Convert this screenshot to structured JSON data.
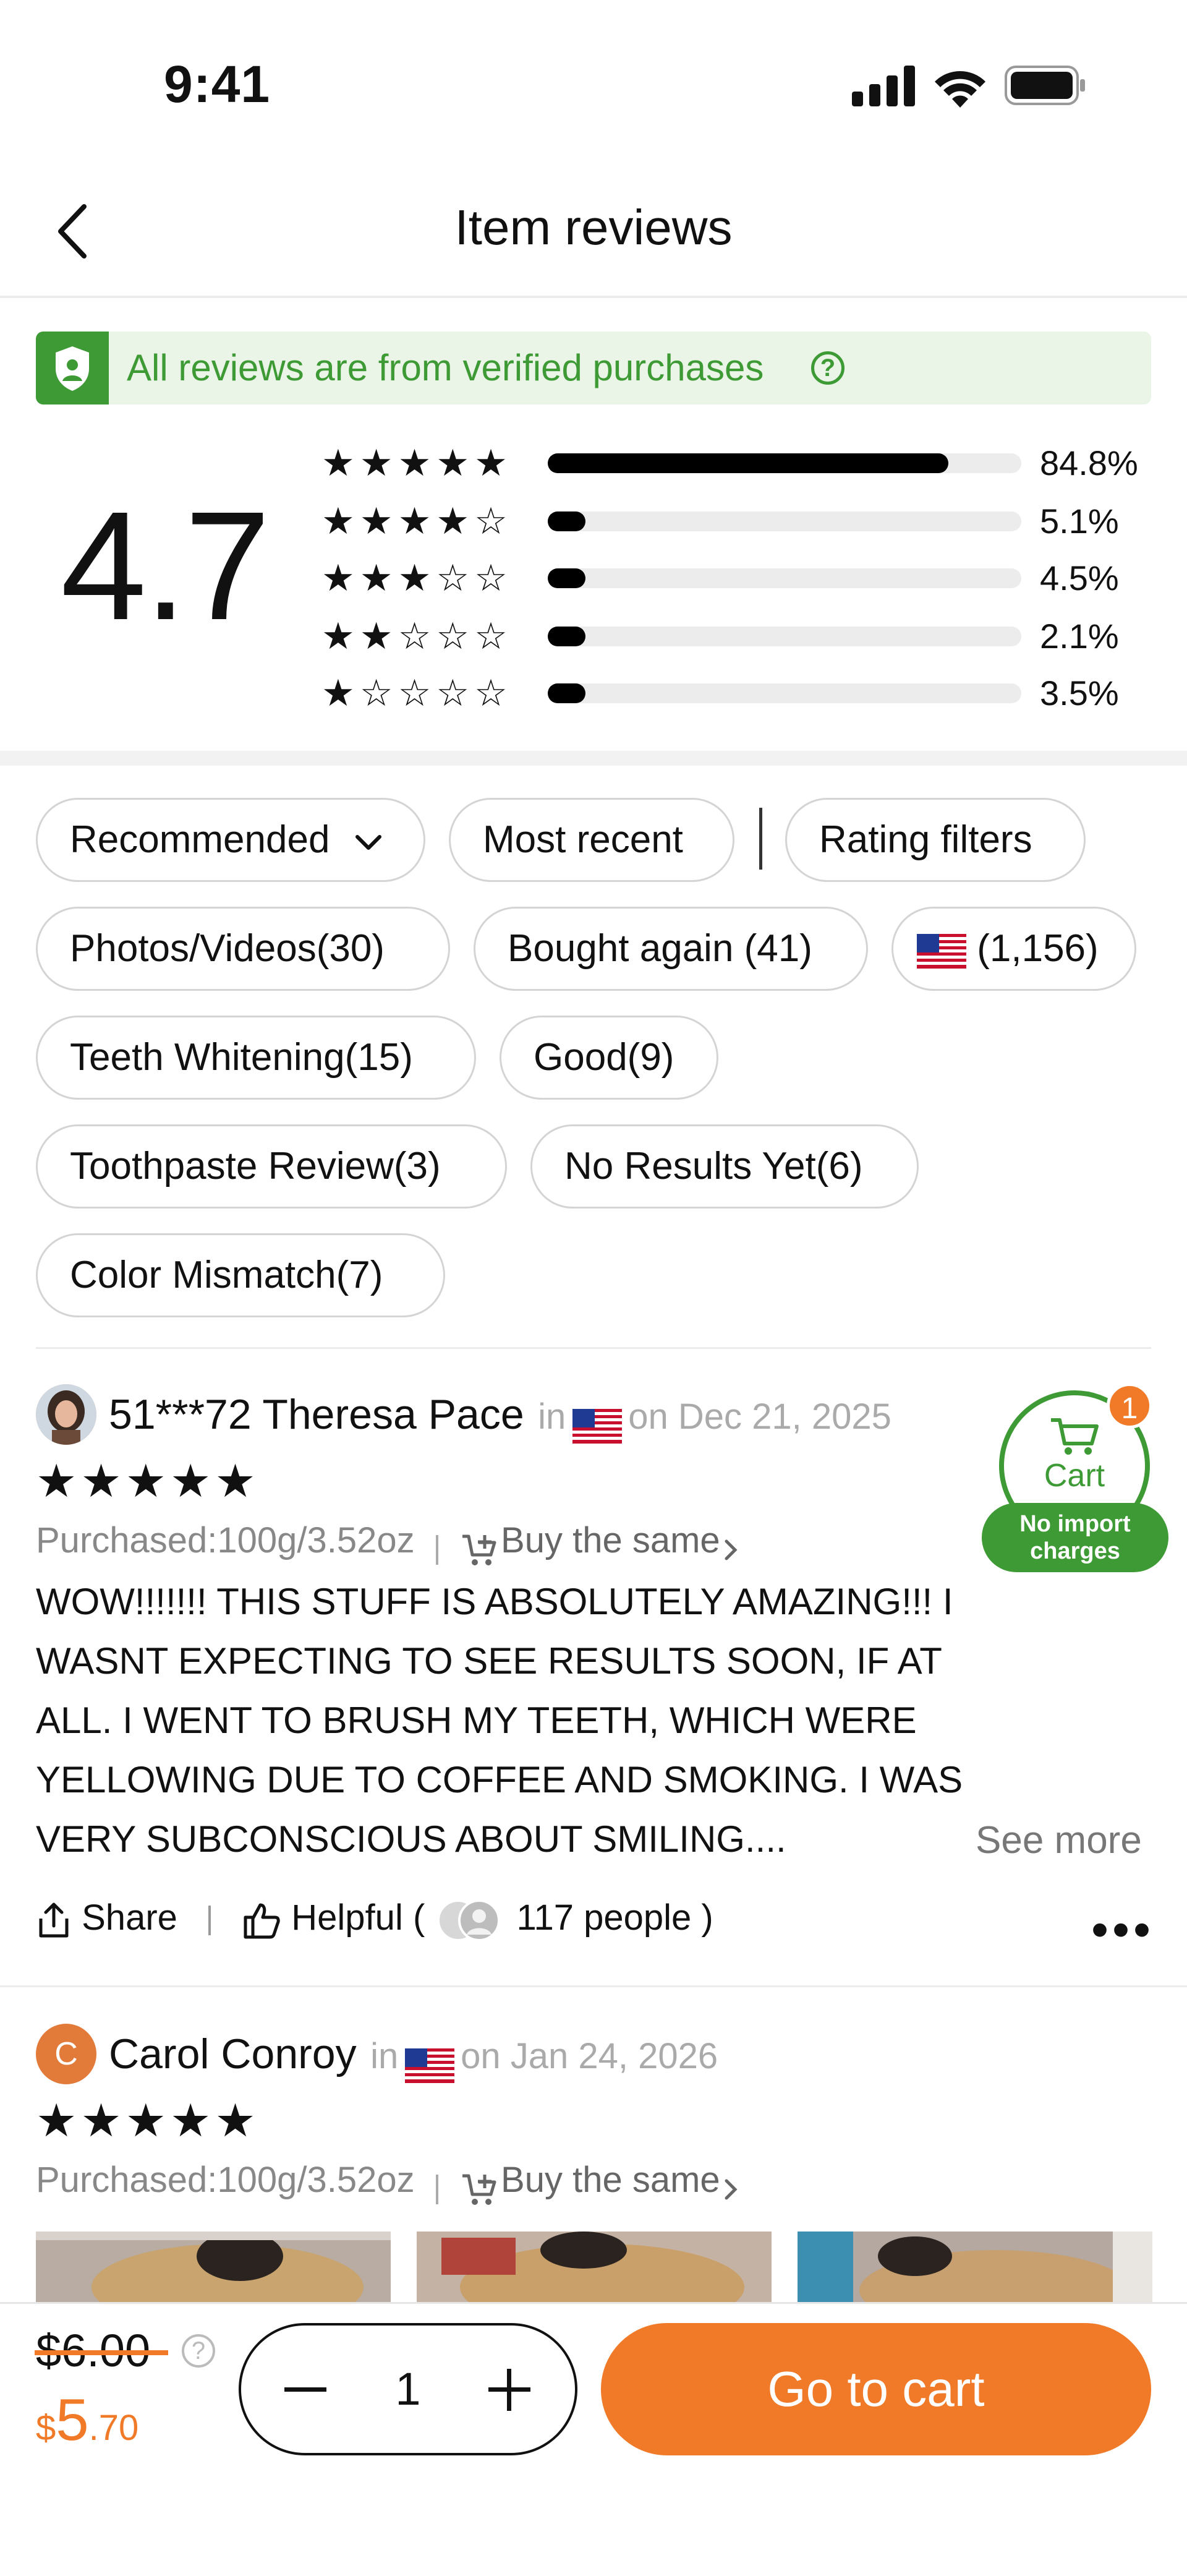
{
  "status_bar": {
    "time": "9:41"
  },
  "nav": {
    "title": "Item reviews"
  },
  "verified_banner": {
    "text": "All reviews are from verified purchases",
    "help": "?"
  },
  "rating": {
    "average": "4.7",
    "distribution": [
      {
        "stars": 5,
        "percent": "84.8%",
        "value": 84.8
      },
      {
        "stars": 4,
        "percent": "5.1%",
        "value": 5.1
      },
      {
        "stars": 3,
        "percent": "4.5%",
        "value": 4.5
      },
      {
        "stars": 2,
        "percent": "2.1%",
        "value": 2.1
      },
      {
        "stars": 1,
        "percent": "3.5%",
        "value": 3.5
      }
    ]
  },
  "filters": {
    "sort": "Recommended",
    "most_recent": "Most recent",
    "rating_filters": "Rating filters",
    "chips": [
      "Photos/Videos(30)",
      "Bought again (41)",
      "(1,156)",
      "Teeth Whitening(15)",
      "Good(9)",
      "Toothpaste Review(3)",
      "No Results Yet(6)",
      "Color Mismatch(7)"
    ]
  },
  "reviews": [
    {
      "name": "51***72 Theresa Pace",
      "in": "in",
      "date": "on Dec 21, 2025",
      "stars": "★★★★★",
      "purchased": "Purchased:100g/3.52oz",
      "buy_same": "Buy the same",
      "body": "WOW!!!!!!! THIS STUFF IS ABSOLUTELY AMAZING!!! I WASNT EXPECTING TO SEE RESULTS SOON, IF AT ALL. I WENT TO BRUSH MY TEETH, WHICH WERE YELLOWING DUE TO COFFEE AND SMOKING. I WAS VERY SUBCONSCIOUS ABOUT SMILING....",
      "see_more": "See more",
      "share": "Share",
      "helpful": "Helpful (",
      "helpful_count": "117 people",
      "helpful_close": ")"
    },
    {
      "name": "Carol Conroy",
      "avatar_letter": "C",
      "in": "in",
      "date": "on Jan 24, 2026",
      "stars": "★★★★★",
      "purchased": "Purchased:100g/3.52oz",
      "buy_same": "Buy the same"
    }
  ],
  "cart_float": {
    "label": "Cart",
    "badge": "1",
    "note": "No import charges"
  },
  "bottom_bar": {
    "old_price": "$6.00",
    "price_currency": "$",
    "price_whole": "5",
    "price_cents": ".70",
    "quantity": "1",
    "go_to_cart": "Go to cart"
  },
  "colors": {
    "accent": "#f07a28",
    "verified_green": "#3d9a34"
  }
}
